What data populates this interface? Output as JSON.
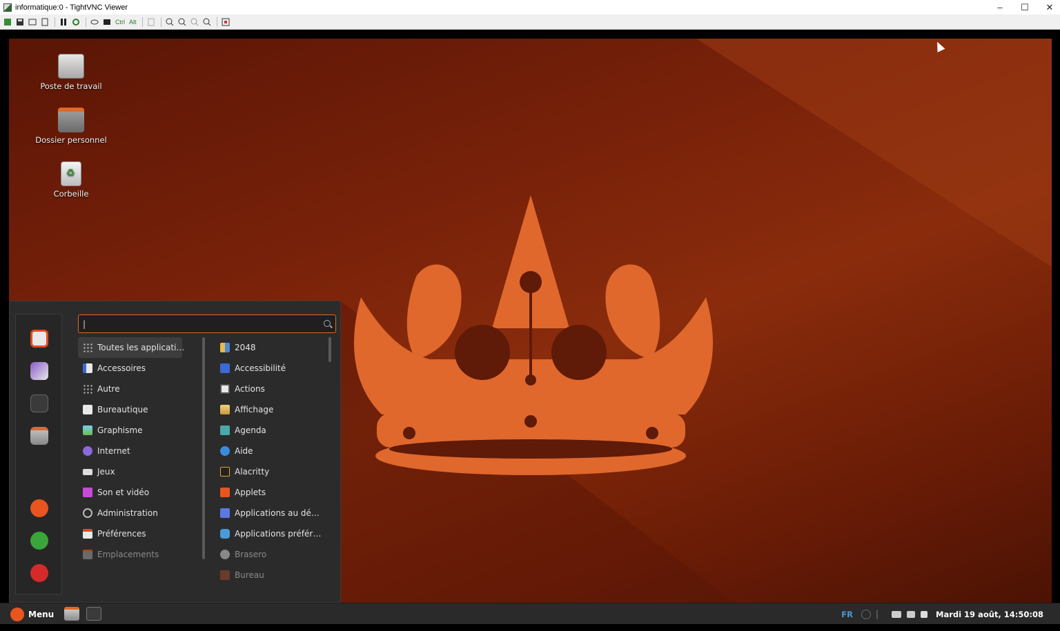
{
  "window": {
    "title": "informatique:0 - TightVNC Viewer",
    "controls": {
      "minimize": "–",
      "maximize": "☐",
      "close": "✕"
    }
  },
  "vnc_toolbar": {
    "items": [
      "new-connection",
      "save",
      "options",
      "info",
      "pause",
      "refresh",
      "send-ctrl-alt-del",
      "ctrl-esc",
      "Ctrl",
      "Alt",
      "clipboard",
      "zoom-in",
      "zoom-out",
      "zoom-100",
      "zoom-fit",
      "fullscreen"
    ],
    "ctrl_label": "Ctrl",
    "alt_label": "Alt"
  },
  "desktop": {
    "icons": [
      {
        "label": "Poste de travail",
        "icon": "computer-icon"
      },
      {
        "label": "Dossier personnel",
        "icon": "home-folder-icon"
      },
      {
        "label": "Corbeille",
        "icon": "trash-icon"
      }
    ]
  },
  "menu": {
    "search": {
      "value": "|",
      "placeholder": ""
    },
    "categories": [
      {
        "label": "Toutes les applicati…",
        "selected": true
      },
      {
        "label": "Accessoires"
      },
      {
        "label": "Autre"
      },
      {
        "label": "Bureautique"
      },
      {
        "label": "Graphisme"
      },
      {
        "label": "Internet"
      },
      {
        "label": "Jeux"
      },
      {
        "label": "Son et vidéo"
      },
      {
        "label": "Administration"
      },
      {
        "label": "Préférences"
      },
      {
        "label": "Emplacements",
        "dim": true
      }
    ],
    "apps": [
      {
        "label": "2048"
      },
      {
        "label": "Accessibilité"
      },
      {
        "label": "Actions"
      },
      {
        "label": "Affichage"
      },
      {
        "label": "Agenda"
      },
      {
        "label": "Aide"
      },
      {
        "label": "Alacritty"
      },
      {
        "label": "Applets"
      },
      {
        "label": "Applications au dé…"
      },
      {
        "label": "Applications préfér…"
      },
      {
        "label": "Brasero",
        "dim": true
      },
      {
        "label": "Bureau",
        "dim": true
      }
    ],
    "favorites": [
      "settings-icon",
      "software-icon",
      "terminal-icon",
      "files-icon",
      "lock-icon",
      "logout-icon",
      "power-icon"
    ]
  },
  "panel": {
    "menu_label": "Menu",
    "language": "FR",
    "clock": "Mardi 19 août, 14:50:08"
  },
  "colors": {
    "accent": "#e9541f",
    "panel": "#2a2a2a",
    "menu_bg": "#2b2b2b",
    "lang": "#4a9cd6"
  }
}
